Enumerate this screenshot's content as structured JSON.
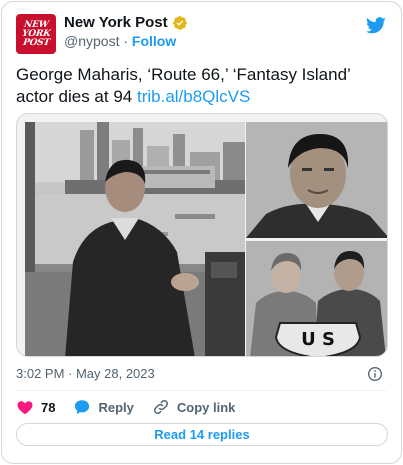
{
  "author": {
    "avatar_lines": [
      "NEW",
      "YORK",
      "POST"
    ],
    "display_name": "New York Post",
    "handle": "@nypost",
    "separator": "·",
    "follow_label": "Follow",
    "verified_icon": "gold-verified-badge-icon"
  },
  "tweet": {
    "text": "George Maharis, ‘Route 66,’ ‘Fantasy Island’ actor dies at 94",
    "link": "trib.al/b8QlcVS"
  },
  "media": {
    "photo_badge_text": "U S"
  },
  "footer": {
    "timestamp": "3:02 PM · May 28, 2023",
    "likes_count": "78",
    "reply_label": "Reply",
    "copy_link_label": "Copy link",
    "read_replies_label": "Read 14 replies"
  },
  "colors": {
    "accent": "#1d9bf0",
    "heart": "#f91880",
    "brand_red": "#c8102e",
    "muted": "#536471"
  }
}
